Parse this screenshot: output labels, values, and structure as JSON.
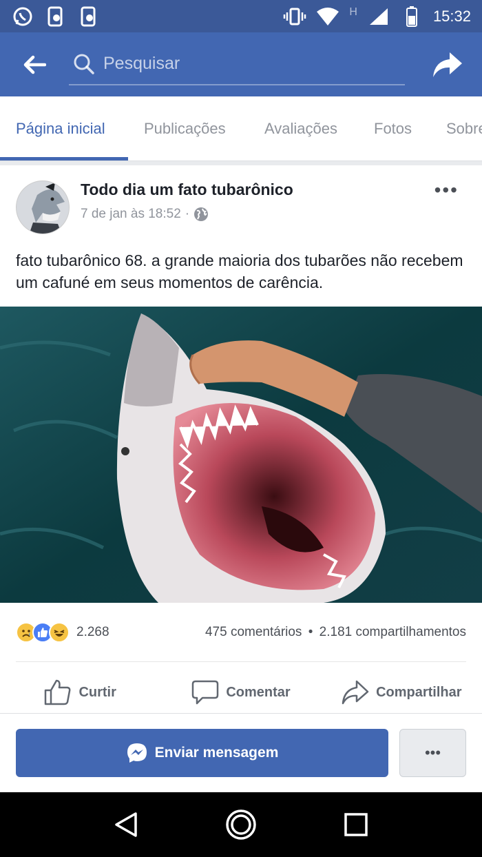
{
  "status_bar": {
    "time": "15:32",
    "network_letter": "H",
    "icons": [
      "whatsapp-icon",
      "phone-lock-icon",
      "phone-lock-icon",
      "vibrate-icon",
      "wifi-icon",
      "signal-icon",
      "battery-icon"
    ]
  },
  "header": {
    "search_placeholder": "Pesquisar",
    "back_icon": "arrow-left-icon",
    "share_icon": "share-arrow-icon"
  },
  "tabs": [
    {
      "label": "Página inicial",
      "active": true
    },
    {
      "label": "Publicações",
      "active": false
    },
    {
      "label": "Avaliações",
      "active": false
    },
    {
      "label": "Fotos",
      "active": false
    },
    {
      "label": "Sobre",
      "active": false
    }
  ],
  "post": {
    "page_name": "Todo dia um fato tubarônico",
    "timestamp": "7 de jan às 18:52",
    "separator": "·",
    "more_label": "•••",
    "text": "fato tubarônico 68. a grande maioria dos tubarões não recebem um cafuné em seus momentos de carência.",
    "reactions": [
      "sad",
      "like",
      "haha"
    ],
    "reaction_count": "2.268",
    "comments": "475 comentários",
    "dot": "•",
    "shares": "2.181 compartilhamentos",
    "actions": {
      "like": "Curtir",
      "comment": "Comentar",
      "share": "Compartilhar"
    }
  },
  "message_bar": {
    "send_label": "Enviar mensagem",
    "more_label": "•••"
  },
  "colors": {
    "status_bg": "#3b5998",
    "header_bg": "#4267b2",
    "accent": "#4267b2"
  }
}
